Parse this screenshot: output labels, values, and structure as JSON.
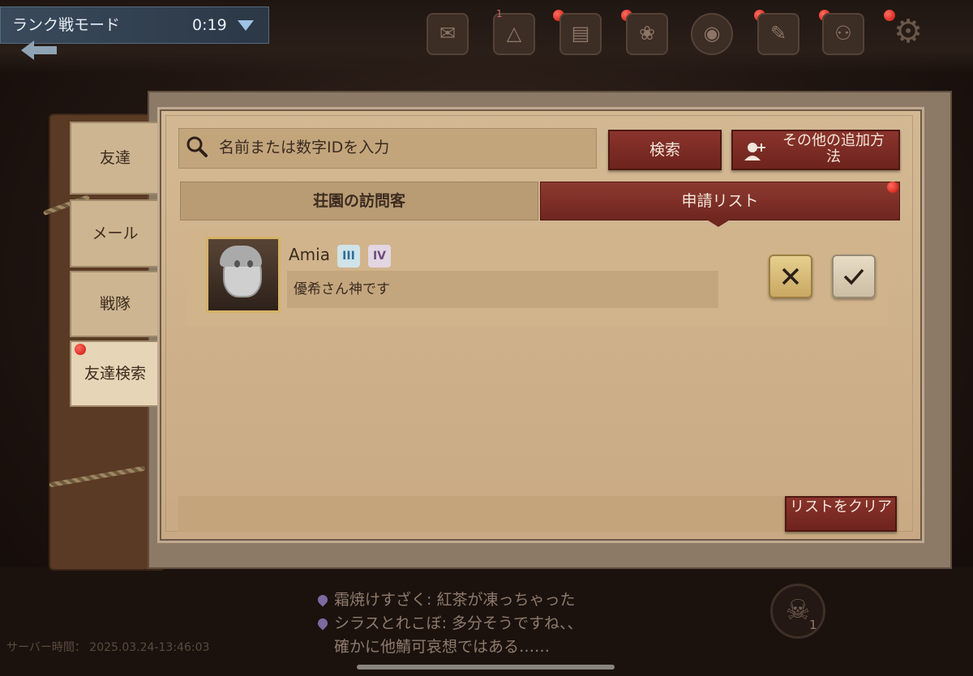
{
  "top_bar": {
    "mode_label": "ランク戦モード",
    "timer": "0:19",
    "menu_icons": [
      {
        "icon": "mail-icon",
        "glyph": "✉"
      },
      {
        "icon": "alert-icon",
        "glyph": "△",
        "badge": "1"
      },
      {
        "icon": "film-icon",
        "glyph": "▤"
      },
      {
        "icon": "gallery-icon",
        "glyph": "❀"
      },
      {
        "icon": "portrait-icon",
        "glyph": "◉"
      },
      {
        "icon": "notebook-icon",
        "glyph": "✎"
      },
      {
        "icon": "friends-icon",
        "glyph": "👥"
      },
      {
        "icon": "settings-icon",
        "glyph": "⚙"
      }
    ]
  },
  "side_tabs": [
    "友達",
    "メール",
    "戦隊",
    "友達検索"
  ],
  "active_side_tab": "友達検索",
  "search": {
    "placeholder": "名前または数字IDを入力",
    "search_button": "検索",
    "other_button": "その他の追加方法"
  },
  "tabs": {
    "visitors": "荘園の訪問客",
    "requests": "申請リスト"
  },
  "active_tab": "申請リスト",
  "requests": [
    {
      "name": "Amia",
      "badge1": "III",
      "badge2": "IV",
      "message": "優希さん神です"
    }
  ],
  "clear_button": "リストをクリア",
  "chat": [
    "霜焼けすざく: 紅茶が凍っちゃった",
    "シラスとれこぼ: 多分そうですね、、",
    "確かに他鯖可哀想ではある……"
  ],
  "server_time": "サーバー時間： 2025.03.24-13:46:03",
  "skull_count": "1",
  "colors": {
    "accent_red": "#7d2e25",
    "parchment": "#d3b993",
    "notification_dot": "#e0241b"
  }
}
